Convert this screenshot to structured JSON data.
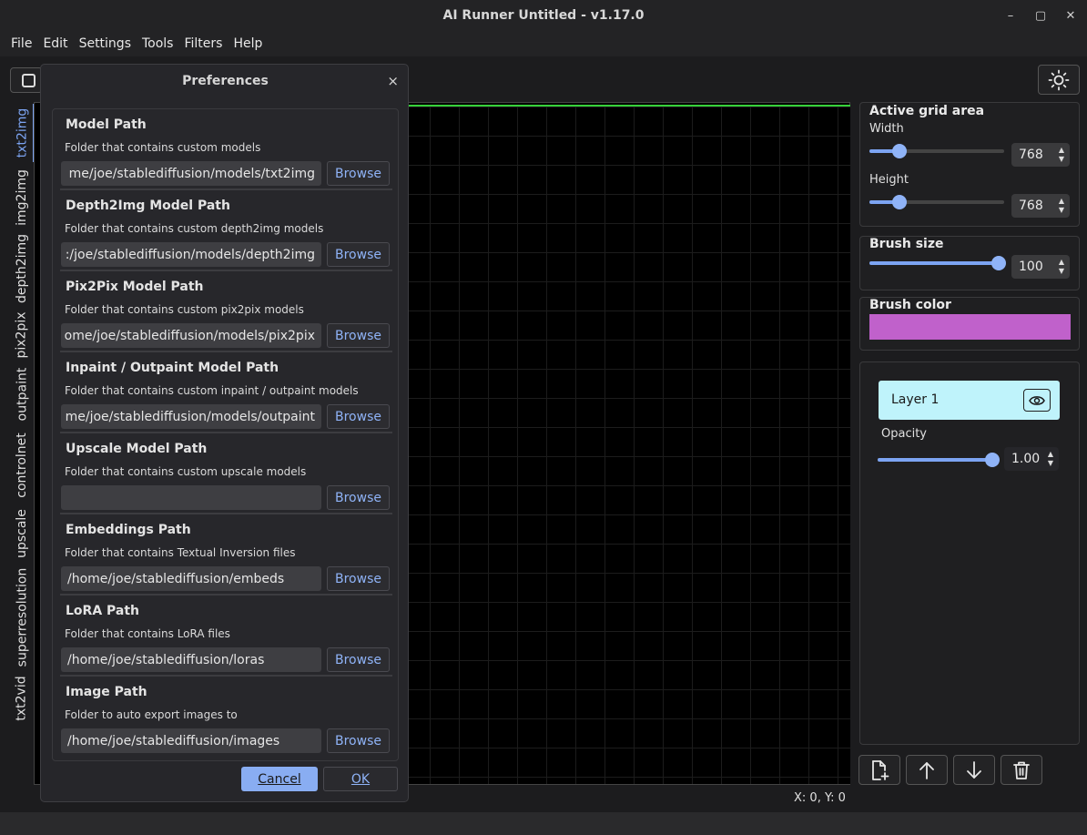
{
  "window": {
    "title": "AI Runner Untitled - v1.17.0",
    "controls": [
      "–",
      "▢",
      "✕"
    ]
  },
  "menu": [
    "File",
    "Edit",
    "Settings",
    "Tools",
    "Filters",
    "Help"
  ],
  "left_tabs": [
    "txt2img",
    "img2img",
    "depth2img",
    "pix2pix",
    "outpaint",
    "controlnet",
    "upscale",
    "superresolution",
    "txt2vid"
  ],
  "active_tab": "txt2img",
  "canvas": {
    "coords": "X: 0, Y: 0"
  },
  "right_panel": {
    "grid_title": "Active grid area",
    "width_label": "Width",
    "width_value": "768",
    "height_label": "Height",
    "height_value": "768",
    "brush_size_title": "Brush size",
    "brush_size_value": "100",
    "brush_color_title": "Brush color",
    "brush_color": "#c061cb"
  },
  "layers": {
    "layer_name": "Layer 1",
    "opacity_label": "Opacity",
    "opacity_value": "1.00"
  },
  "dialog": {
    "title": "Preferences",
    "close": "×",
    "sections": [
      {
        "title": "Model Path",
        "desc": "Folder that contains custom models",
        "value": "me/joe/stablediffusion/models/txt2img",
        "browse": "Browse"
      },
      {
        "title": "Depth2Img Model Path",
        "desc": "Folder that contains custom depth2img models",
        "value": ":/joe/stablediffusion/models/depth2img",
        "browse": "Browse"
      },
      {
        "title": "Pix2Pix Model Path",
        "desc": "Folder that contains custom pix2pix models",
        "value": "ome/joe/stablediffusion/models/pix2pix",
        "browse": "Browse"
      },
      {
        "title": "Inpaint / Outpaint Model Path",
        "desc": "Folder that contains custom inpaint / outpaint models",
        "value": "me/joe/stablediffusion/models/outpaint",
        "browse": "Browse"
      },
      {
        "title": "Upscale Model Path",
        "desc": "Folder that contains custom upscale models",
        "value": "",
        "browse": "Browse"
      },
      {
        "title": "Embeddings Path",
        "desc": "Folder that contains Textual Inversion files",
        "value": "/home/joe/stablediffusion/embeds",
        "browse": "Browse"
      },
      {
        "title": "LoRA Path",
        "desc": "Folder that contains LoRA files",
        "value": "/home/joe/stablediffusion/loras",
        "browse": "Browse"
      },
      {
        "title": "Image Path",
        "desc": "Folder to auto export images to",
        "value": "/home/joe/stablediffusion/images",
        "browse": "Browse"
      }
    ],
    "cancel": "Cancel",
    "ok": "OK"
  },
  "colors": {
    "accent": "#7ca4f2",
    "canvas_border": "#36d13a",
    "layer_bg": "#bff3fb"
  },
  "icons": [
    "sun-icon",
    "checkbox-icon",
    "eye-icon",
    "new-layer-icon",
    "arrow-up-icon",
    "arrow-down-icon",
    "trash-icon"
  ]
}
